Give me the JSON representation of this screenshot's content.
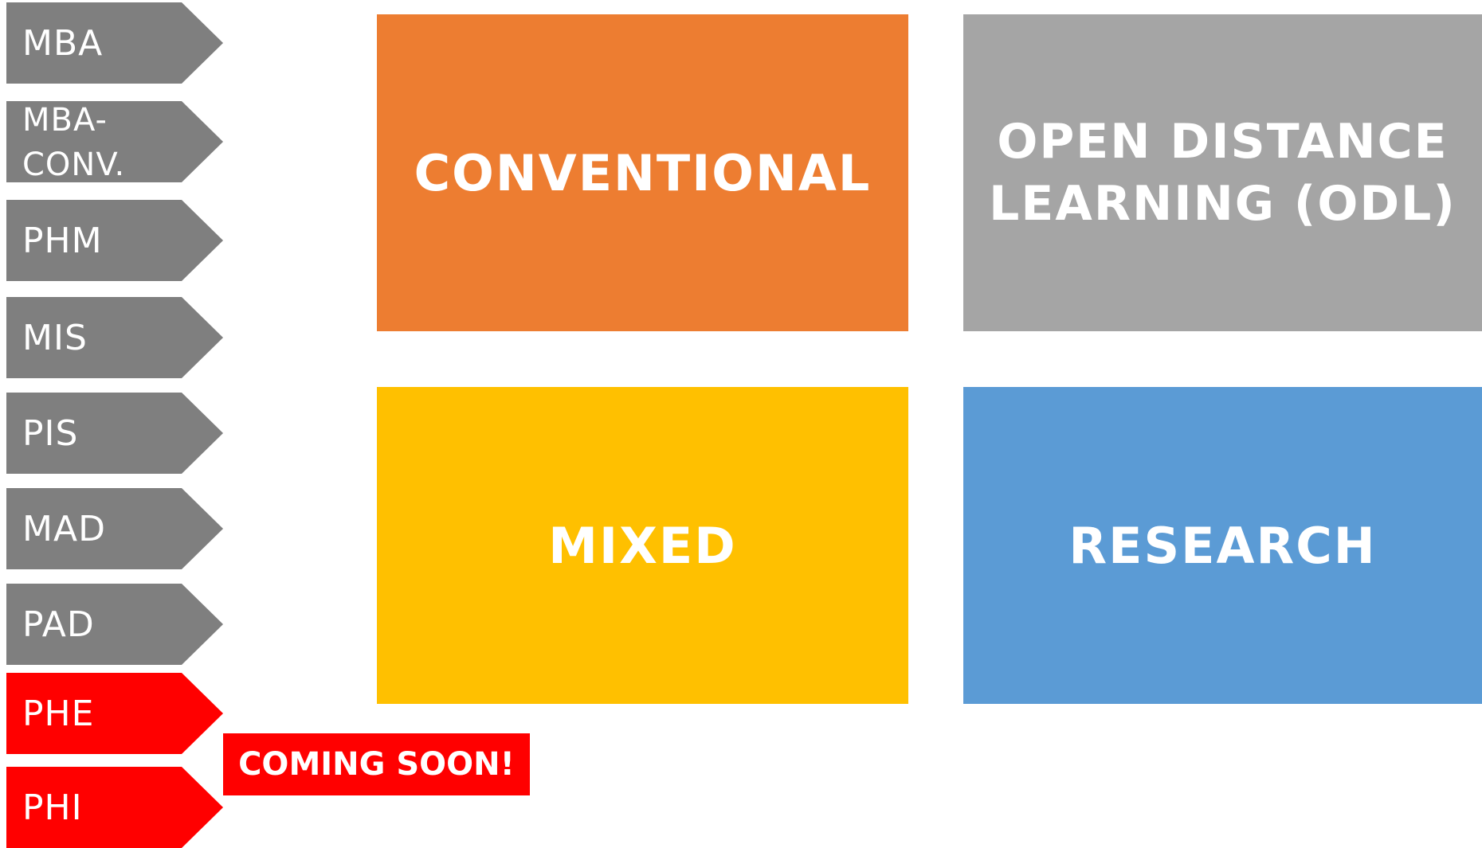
{
  "colors": {
    "tab_gray": "#7f7f7f",
    "tab_red": "#ff0000",
    "conventional": "#ed7d31",
    "odl": "#a5a5a5",
    "mixed": "#ffc000",
    "research": "#5b9bd5"
  },
  "programs": [
    {
      "label": "MBA"
    },
    {
      "label": "MBA-\nCONV."
    },
    {
      "label": "PHM"
    },
    {
      "label": "MIS"
    },
    {
      "label": "PIS"
    },
    {
      "label": "MAD"
    },
    {
      "label": "PAD"
    },
    {
      "label": "PHE"
    },
    {
      "label": "PHI"
    }
  ],
  "categories": {
    "conventional": "CONVENTIONAL",
    "odl": "OPEN DISTANCE\nLEARNING (ODL)",
    "mixed": "MIXED",
    "research": "RESEARCH"
  },
  "badge": {
    "coming_soon": "COMING SOON!"
  }
}
